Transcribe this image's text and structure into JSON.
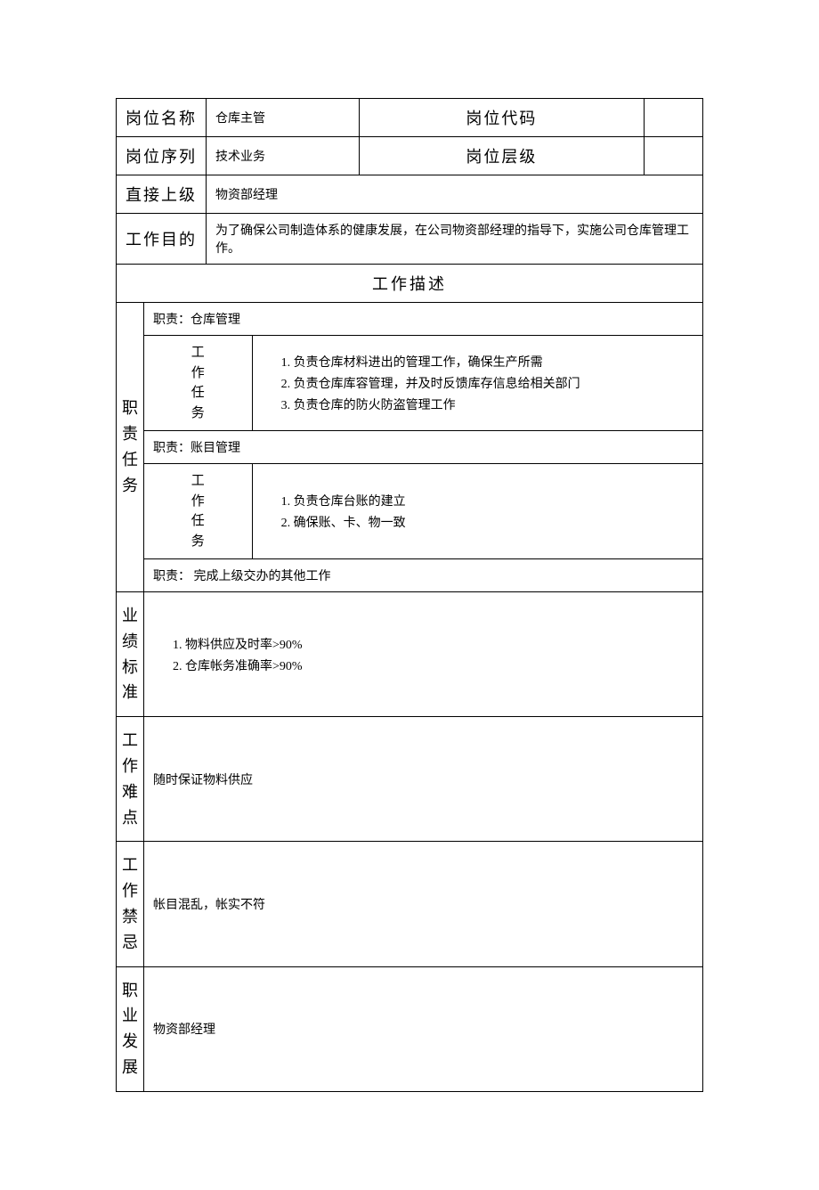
{
  "header": {
    "positionNameLabel": "岗位名称",
    "positionName": "仓库主管",
    "positionCodeLabel": "岗位代码",
    "positionCode": "",
    "positionSeriesLabel": "岗位序列",
    "positionSeries": "技术业务",
    "positionLevelLabel": "岗位层级",
    "positionLevel": "",
    "supervisorLabel": "直接上级",
    "supervisor": "物资部经理",
    "purposeLabel": "工作目的",
    "purpose": "为了确保公司制造体系的健康发展，在公司物资部经理的指导下，实施公司仓库管理工作。"
  },
  "jobDescTitle": "工作描述",
  "dutyLabel": "职责任务",
  "taskLabel": "工作任务",
  "duties": [
    {
      "title": "职责：仓库管理",
      "tasks": [
        "负责仓库材料进出的管理工作，确保生产所需",
        "负责仓库库容管理，并及时反馈库存信息给相关部门",
        "负责仓库的防火防盗管理工作"
      ]
    },
    {
      "title": "职责：账目管理",
      "tasks": [
        "负责仓库台账的建立",
        "确保账、卡、物一致"
      ]
    },
    {
      "title": "职责：  完成上级交办的其他工作"
    }
  ],
  "perfLabel": "业绩标准",
  "perfItems": [
    "物料供应及时率>90%",
    "仓库帐务准确率>90%"
  ],
  "difficultyLabel": "工作难点",
  "difficulty": "随时保证物料供应",
  "tabooLabel": "工作禁忌",
  "taboo": "帐目混乱，帐实不符",
  "careerLabel": "职业发展",
  "career": "物资部经理"
}
